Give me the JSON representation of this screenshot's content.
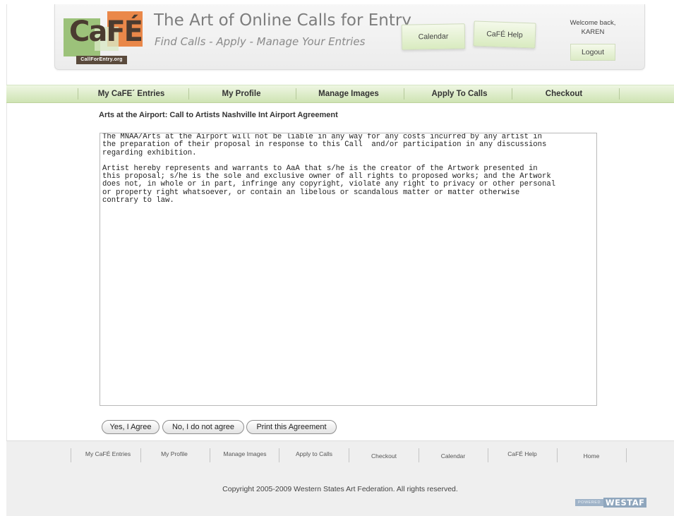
{
  "header": {
    "logo_word": "CaFÉ",
    "logo_sub": "CallForEntry.org",
    "title": "The Art of Online Calls for Entry",
    "subtitle": "Find Calls - Apply - Manage Your Entries",
    "calendar_label": "Calendar",
    "help_label": "CaFÉ Help",
    "welcome_text": "Welcome back,",
    "user_name": "KAREN",
    "logout_label": "Logout"
  },
  "topnav": {
    "items": [
      {
        "label": "My CaFE´ Entries"
      },
      {
        "label": "My Profile"
      },
      {
        "label": "Manage Images"
      },
      {
        "label": "Apply To Calls"
      },
      {
        "label": "Checkout"
      }
    ]
  },
  "main": {
    "heading": "Arts at the Airport: Call to Artists Nashville Int Airport Agreement",
    "agreement_paragraphs": [
      "The MNAA/Arts at the Airport will not be liable in any way for any costs incurred by any artist in\nthe preparation of their proposal in response to this Call  and/or participation in any discussions\nregarding exhibition.",
      "Artist hereby represents and warrants to AaA that s/he is the creator of the Artwork presented in\nthis proposal; s/he is the sole and exclusive owner of all rights to proposed works; and the Artwork\ndoes not, in whole or in part, infringe any copyright, violate any right to privacy or other personal\nor property right whatsoever, or contain an libelous or scandalous matter or matter otherwise\ncontrary to law."
    ],
    "buttons": {
      "agree": "Yes, I Agree",
      "disagree": "No, I do not agree",
      "print": "Print this Agreement"
    }
  },
  "footer": {
    "nav": [
      {
        "label": "My CaFÉ Entries"
      },
      {
        "label": "My Profile"
      },
      {
        "label": "Manage Images"
      },
      {
        "label": "Apply to Calls"
      },
      {
        "label": "Checkout"
      },
      {
        "label": "Calendar"
      },
      {
        "label": "CaFÉ Help"
      },
      {
        "label": "Home"
      }
    ],
    "copyright": "Copyright 2005-2009 Western States Art Federation. All rights reserved.",
    "powered_by": "POWERED BY",
    "powered_brand": "WESTAF"
  },
  "colors": {
    "nav_green": "#cfe4b4",
    "logo_green": "#9cc27a",
    "logo_orange": "#e8742c",
    "logo_brown": "#5a4a3c"
  }
}
